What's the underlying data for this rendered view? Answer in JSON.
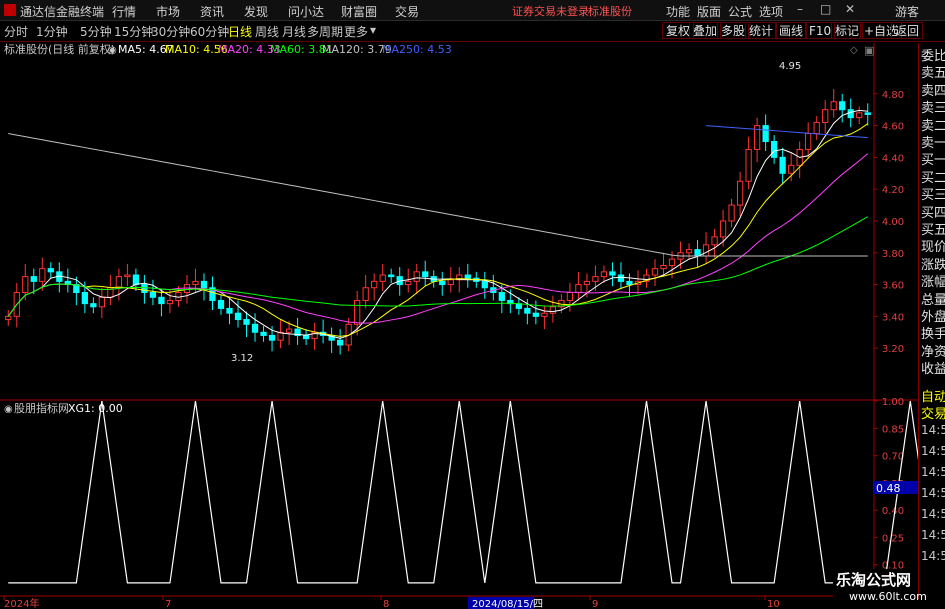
{
  "menubar": {
    "app_title": "通达信金融终端",
    "items": [
      "行情",
      "市场",
      "资讯",
      "发现",
      "问小达",
      "财富圈",
      "交易"
    ],
    "status_login": "证券交易未登录",
    "status_stock": "标准股份",
    "right_items": [
      "功能",
      "版面",
      "公式",
      "选项"
    ],
    "guest": "游客"
  },
  "toolbar": {
    "periods": [
      "分时",
      "1分钟",
      "5分钟",
      "15分钟",
      "30分钟",
      "60分钟",
      "日线",
      "周线",
      "月线",
      "多周期",
      "更多"
    ],
    "active_period": "日线",
    "right_buttons": [
      "复权",
      "叠加",
      "多股",
      "统计",
      "画线",
      "F10",
      "标记",
      "+自选",
      "返回"
    ]
  },
  "main_chart": {
    "title": "标准股份(日线 前复权)",
    "ma": [
      {
        "label": "MA5: 4.67",
        "color": "#ffffff"
      },
      {
        "label": "MA10: 4.56",
        "color": "#ffff00"
      },
      {
        "label": "MA20: 4.33",
        "color": "#ff40ff"
      },
      {
        "label": "MA60: 3.81",
        "color": "#00ff00"
      },
      {
        "label": "MA120: 3.79",
        "color": "#c0c0c0"
      },
      {
        "label": "MA250: 4.53",
        "color": "#4060ff"
      }
    ],
    "high_label": "4.95",
    "low_label": "3.12"
  },
  "indicator": {
    "name": "股朋指标网",
    "value_label": "XG1: 0.00",
    "current_value": "0.48"
  },
  "x_axis": {
    "labels": [
      "2024年",
      "7",
      "8",
      "2024/08/15/四",
      "9",
      "10"
    ]
  },
  "right_panel": {
    "quote_labels": [
      "委比",
      "卖五",
      "卖四",
      "卖三",
      "卖二",
      "卖一",
      "买一",
      "买二",
      "买三",
      "买四",
      "买五",
      "现价",
      "涨跌",
      "涨幅",
      "总量",
      "外盘",
      "换手",
      "净资",
      "收益"
    ],
    "auto_labels": [
      "自动",
      "交易"
    ],
    "times": [
      "14:55",
      "14:56",
      "14:56",
      "14:56",
      "14:56",
      "14:56",
      "14:56"
    ]
  },
  "watermark": {
    "title": "乐淘公式网",
    "url": "www.60lt.com"
  },
  "chart_data": [
    {
      "type": "candlestick",
      "y_ticks": [
        "4.80",
        "4.60",
        "4.40",
        "4.20",
        "4.00",
        "3.80",
        "3.60",
        "3.40",
        "3.20"
      ],
      "ylim": [
        3.05,
        5.0
      ],
      "close": [
        3.4,
        3.55,
        3.65,
        3.62,
        3.7,
        3.68,
        3.62,
        3.6,
        3.55,
        3.48,
        3.46,
        3.52,
        3.58,
        3.65,
        3.66,
        3.6,
        3.55,
        3.52,
        3.48,
        3.5,
        3.55,
        3.6,
        3.62,
        3.58,
        3.5,
        3.45,
        3.42,
        3.38,
        3.35,
        3.3,
        3.28,
        3.25,
        3.3,
        3.32,
        3.28,
        3.26,
        3.3,
        3.28,
        3.25,
        3.22,
        3.35,
        3.5,
        3.58,
        3.62,
        3.66,
        3.65,
        3.6,
        3.62,
        3.68,
        3.65,
        3.62,
        3.6,
        3.63,
        3.66,
        3.64,
        3.62,
        3.58,
        3.55,
        3.5,
        3.48,
        3.45,
        3.42,
        3.4,
        3.42,
        3.46,
        3.5,
        3.55,
        3.6,
        3.62,
        3.65,
        3.68,
        3.66,
        3.62,
        3.6,
        3.62,
        3.66,
        3.7,
        3.72,
        3.76,
        3.8,
        3.82,
        3.78,
        3.85,
        3.9,
        4.0,
        4.1,
        4.25,
        4.45,
        4.6,
        4.5,
        4.4,
        4.3,
        4.35,
        4.45,
        4.55,
        4.62,
        4.7,
        4.75,
        4.7,
        4.65,
        4.68,
        4.67
      ]
    },
    {
      "type": "line",
      "y_ticks": [
        "1.00",
        "0.85",
        "0.70",
        "0.55",
        "0.40",
        "0.25",
        "0.10"
      ],
      "ylim": [
        -0.05,
        1.05
      ],
      "peaks": [
        11,
        22,
        31,
        44,
        53,
        59,
        75,
        82,
        93,
        106
      ]
    }
  ]
}
